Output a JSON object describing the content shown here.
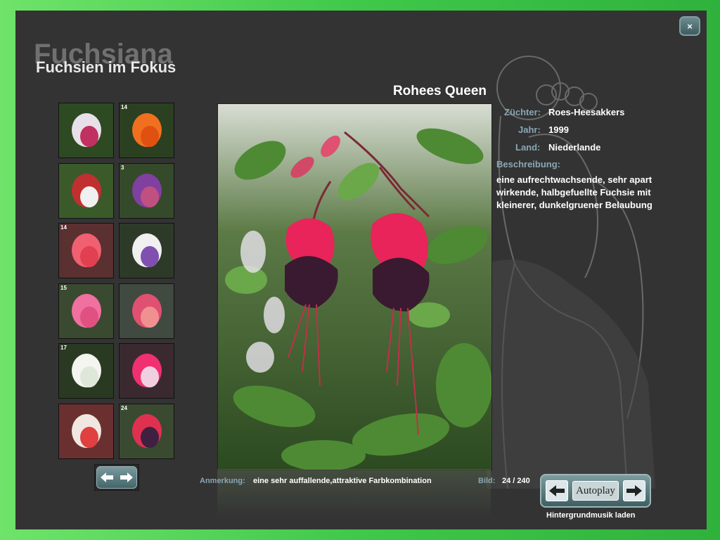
{
  "window": {
    "close_label": "×"
  },
  "brand": {
    "background_title": "Fuchsiana",
    "title": "Fuchsien im Fokus"
  },
  "photo": {
    "title": "Rohees Queen"
  },
  "details": {
    "breeder_label": "Züchter:",
    "breeder": "Roes-Heesakkers",
    "year_label": "Jahr:",
    "year": "1999",
    "country_label": "Land:",
    "country": "Niederlande",
    "description_label": "Beschreibung:",
    "description": "eine aufrechtwachsende, sehr apart wirkende, halbgefuellte Fuchsie mit kleinerer, dunkelgruener Belaubung"
  },
  "footer": {
    "note_label": "Anmerkung:",
    "note": "eine sehr auffallende,attraktive Farbkombination",
    "image_label": "Bild:",
    "image_counter": "24 / 240",
    "autoplay_label": "Autoplay",
    "music_link": "Hintergrundmusik laden"
  },
  "thumbnails": [
    {
      "number": "",
      "colors": [
        "#2d4a22",
        "#e8e0e8",
        "#c03060"
      ]
    },
    {
      "number": "14",
      "colors": [
        "#2b4020",
        "#f07020",
        "#e05010"
      ]
    },
    {
      "number": "",
      "colors": [
        "#3a5a2a",
        "#c03030",
        "#f0f0f0"
      ]
    },
    {
      "number": "3",
      "colors": [
        "#354a2a",
        "#8040a0",
        "#c05080"
      ]
    },
    {
      "number": "14",
      "colors": [
        "#5a3030",
        "#f06070",
        "#e04050"
      ]
    },
    {
      "number": "",
      "colors": [
        "#2e3a28",
        "#f0f0f0",
        "#8050b0"
      ]
    },
    {
      "number": "15",
      "colors": [
        "#3a4a30",
        "#f070a0",
        "#e05080"
      ]
    },
    {
      "number": "",
      "colors": [
        "#404a40",
        "#e05070",
        "#f09090"
      ]
    },
    {
      "number": "17",
      "colors": [
        "#2a3a22",
        "#f4f4f0",
        "#dfe8d8"
      ]
    },
    {
      "number": "",
      "colors": [
        "#3a2a30",
        "#f03070",
        "#f0d0e0"
      ]
    },
    {
      "number": "",
      "colors": [
        "#6a3030",
        "#f0e8e0",
        "#e04040"
      ]
    },
    {
      "number": "24",
      "colors": [
        "#3a4a30",
        "#e03050",
        "#402040"
      ]
    }
  ],
  "colors": {
    "panel": "#333333",
    "label": "#8aa7b5",
    "accent_green": "#3fc84a"
  }
}
